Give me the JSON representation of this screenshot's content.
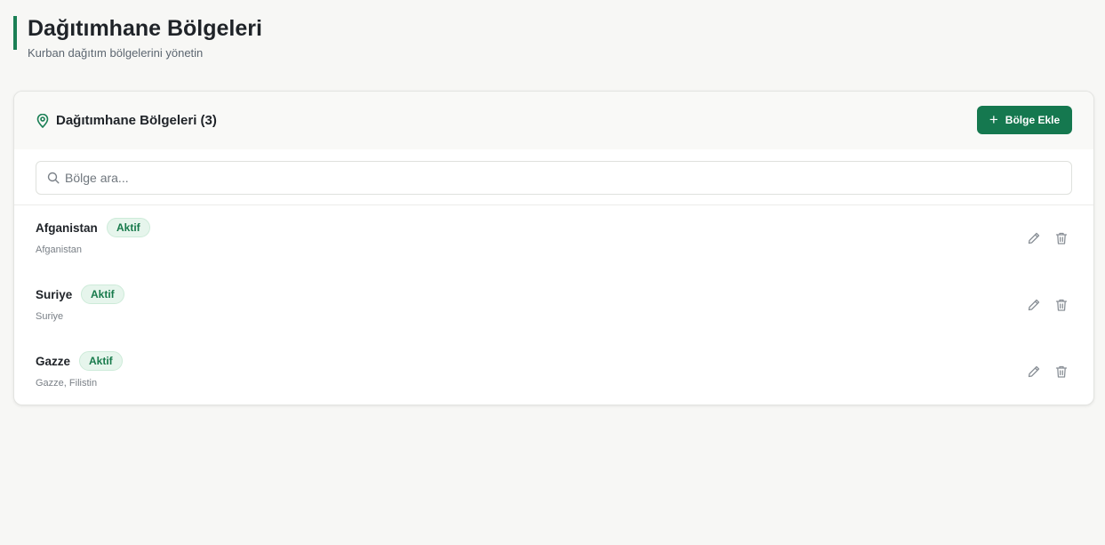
{
  "page": {
    "title": "Dağıtımhane Bölgeleri",
    "subtitle": "Kurban dağıtım bölgelerini yönetin"
  },
  "card": {
    "title": "Dağıtımhane Bölgeleri (3)",
    "header_icon": "map-pin-icon",
    "add_button_label": "Bölge Ekle"
  },
  "search": {
    "placeholder": "Bölge ara...",
    "value": ""
  },
  "regions": [
    {
      "name": "Afganistan",
      "status": "Aktif",
      "description": "Afganistan"
    },
    {
      "name": "Suriye",
      "status": "Aktif",
      "description": "Suriye"
    },
    {
      "name": "Gazze",
      "status": "Aktif",
      "description": "Gazze, Filistin"
    }
  ],
  "colors": {
    "accent": "#15784f",
    "badge_bg": "#e6f5ec",
    "badge_text": "#177a4b"
  }
}
